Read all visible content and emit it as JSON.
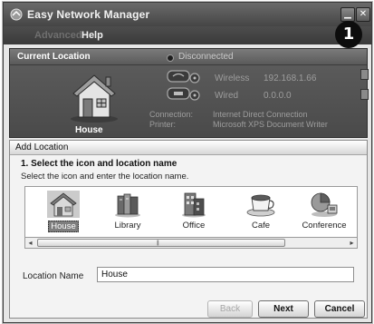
{
  "window": {
    "title": "Easy Network Manager",
    "controls": [
      "minimize",
      "close"
    ]
  },
  "menu": {
    "advanced": "Advanced",
    "help": "Help"
  },
  "callout": "1",
  "current_location": {
    "heading": "Current Location",
    "status": "Disconnected",
    "location_name": "House",
    "wireless_label": "Wireless",
    "wireless_value": "192.168.1.66",
    "wired_label": "Wired",
    "wired_value": "0.0.0.0",
    "connection_label": "Connection:",
    "connection_value": "Internet Direct Connection",
    "printer_label": "Printer:",
    "printer_value": "Microsoft XPS Document Writer"
  },
  "add_location": {
    "heading": "Add Location",
    "step_title": "1. Select the icon and location name",
    "step_subtitle": "Select the icon and enter the location name.",
    "icons": [
      {
        "label": "House",
        "icon": "house-icon",
        "selected": true
      },
      {
        "label": "Library",
        "icon": "library-icon",
        "selected": false
      },
      {
        "label": "Office",
        "icon": "office-icon",
        "selected": false
      },
      {
        "label": "Cafe",
        "icon": "cafe-icon",
        "selected": false
      },
      {
        "label": "Conference",
        "icon": "conference-icon",
        "selected": false
      }
    ],
    "name_label": "Location Name",
    "name_value": "House"
  },
  "buttons": {
    "back": "Back",
    "next": "Next",
    "cancel": "Cancel"
  },
  "colors": {
    "title_bar": "#4a4a4a",
    "panel_dark": "#555555",
    "panel_light": "#f3f3f3",
    "selected_label": "#7e7e7e"
  }
}
